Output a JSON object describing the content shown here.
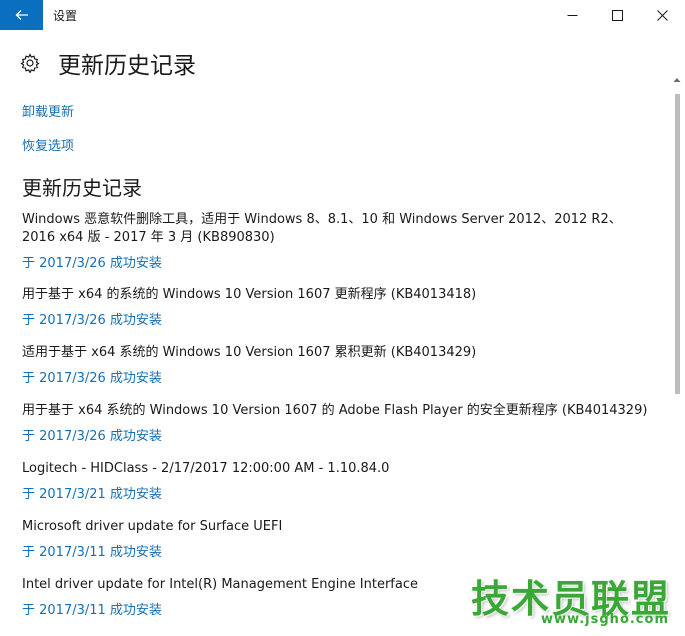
{
  "window": {
    "title": "设置"
  },
  "header": {
    "title": "更新历史记录"
  },
  "links": {
    "uninstall": "卸载更新",
    "recovery": "恢复选项"
  },
  "section": {
    "title": "更新历史记录"
  },
  "updates": [
    {
      "name": "Windows 恶意软件删除工具，适用于 Windows 8、8.1、10 和 Windows Server 2012、2012 R2、 2016 x64 版 - 2017 年 3 月 (KB890830)",
      "status": "于 2017/3/26 成功安装"
    },
    {
      "name": "用于基于 x64 的系统的 Windows 10 Version 1607 更新程序 (KB4013418)",
      "status": "于 2017/3/26 成功安装"
    },
    {
      "name": "适用于基于 x64 系统的 Windows 10 Version 1607 累积更新 (KB4013429)",
      "status": "于 2017/3/26 成功安装"
    },
    {
      "name": "用于基于 x64 系统的 Windows 10 Version 1607 的 Adobe Flash Player 的安全更新程序 (KB4014329)",
      "status": "于 2017/3/26 成功安装"
    },
    {
      "name": "Logitech - HIDClass - 2/17/2017 12:00:00 AM - 1.10.84.0",
      "status": "于 2017/3/21 成功安装"
    },
    {
      "name": "Microsoft driver update for Surface UEFI",
      "status": "于 2017/3/11 成功安装"
    },
    {
      "name": "Intel driver update for Intel(R) Management Engine Interface",
      "status": "于 2017/3/11 成功安装"
    }
  ],
  "watermark": {
    "main": "技术员联盟",
    "url": "www.jsgho.com"
  },
  "icons": {
    "back": "back-arrow-icon",
    "settings": "gear-icon",
    "minimize": "minimize-icon",
    "maximize": "maximize-icon",
    "close": "close-icon"
  },
  "colors": {
    "accent": "#0b6fbf",
    "link": "#1670b5",
    "watermark": "#3aa837"
  }
}
